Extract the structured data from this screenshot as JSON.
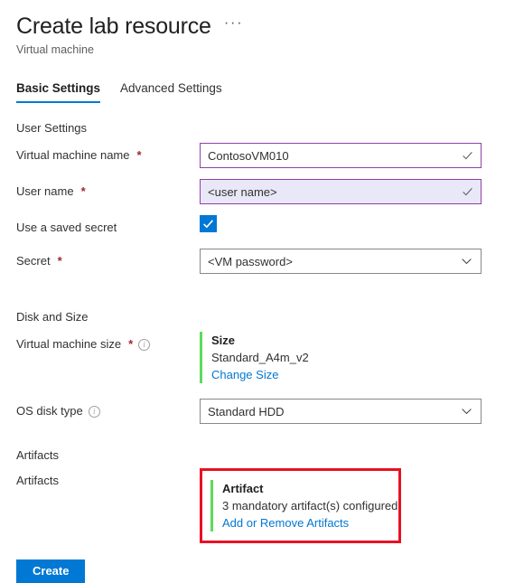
{
  "header": {
    "title": "Create lab resource",
    "subtitle": "Virtual machine",
    "more_menu": "···"
  },
  "tabs": [
    {
      "label": "Basic Settings",
      "active": true
    },
    {
      "label": "Advanced Settings",
      "active": false
    }
  ],
  "sections": {
    "user_settings": {
      "heading": "User Settings",
      "vm_name": {
        "label": "Virtual machine name",
        "required": "*",
        "value": "ContosoVM010"
      },
      "user_name": {
        "label": "User name",
        "required": "*",
        "value": "<user name>"
      },
      "use_saved_secret": {
        "label": "Use a saved secret",
        "checked": true
      },
      "secret": {
        "label": "Secret",
        "required": "*",
        "value": "<VM password>"
      }
    },
    "disk_and_size": {
      "heading": "Disk and Size",
      "vm_size": {
        "label": "Virtual machine size",
        "required": "*",
        "card_title": "Size",
        "card_value": "Standard_A4m_v2",
        "link": "Change Size"
      },
      "os_disk_type": {
        "label": "OS disk type",
        "value": "Standard HDD"
      }
    },
    "artifacts": {
      "heading": "Artifacts",
      "field_label": "Artifacts",
      "card_title": "Artifact",
      "card_value": "3 mandatory artifact(s) configured",
      "link": "Add or Remove Artifacts"
    }
  },
  "footer": {
    "create_label": "Create"
  },
  "colors": {
    "accent_blue": "#0078d4",
    "required_red": "#a4262c",
    "annotation_red": "#e81123",
    "accent_green": "#5ddb5d",
    "input_purple": "#943fa5",
    "autofill_lavender": "#e8e8f8"
  }
}
